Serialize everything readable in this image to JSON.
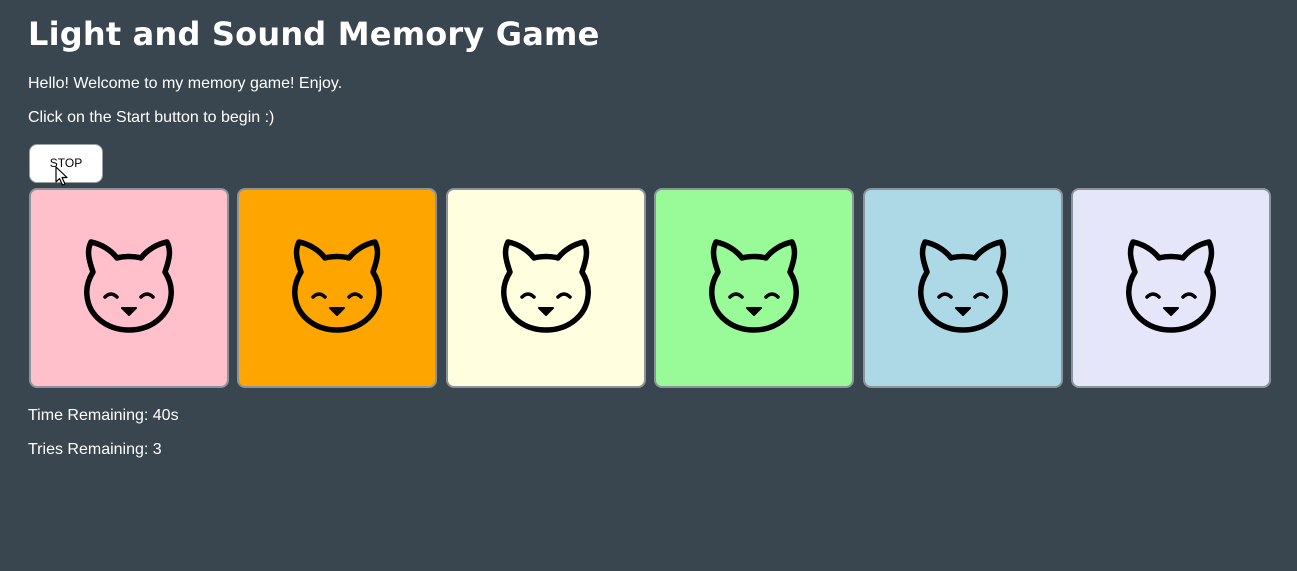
{
  "title": "Light and Sound Memory Game",
  "welcome_text": "Hello! Welcome to my memory game! Enjoy.",
  "instruction_text": "Click on the Start button to begin :)",
  "stop_button_label": "STOP",
  "cards": [
    {
      "color": "#ffc0cb",
      "icon": "cat-face-icon"
    },
    {
      "color": "#ffa500",
      "icon": "cat-face-icon"
    },
    {
      "color": "#ffffe0",
      "icon": "cat-face-icon"
    },
    {
      "color": "#98fb98",
      "icon": "cat-face-icon"
    },
    {
      "color": "#add8e6",
      "icon": "cat-face-icon"
    },
    {
      "color": "#e6e6fa",
      "icon": "cat-face-icon"
    }
  ],
  "status": {
    "time_label": "Time Remaining: 40s",
    "tries_label": "Tries Remaining: 3"
  },
  "colors": {
    "background": "#39464f",
    "text": "#ffffff"
  }
}
